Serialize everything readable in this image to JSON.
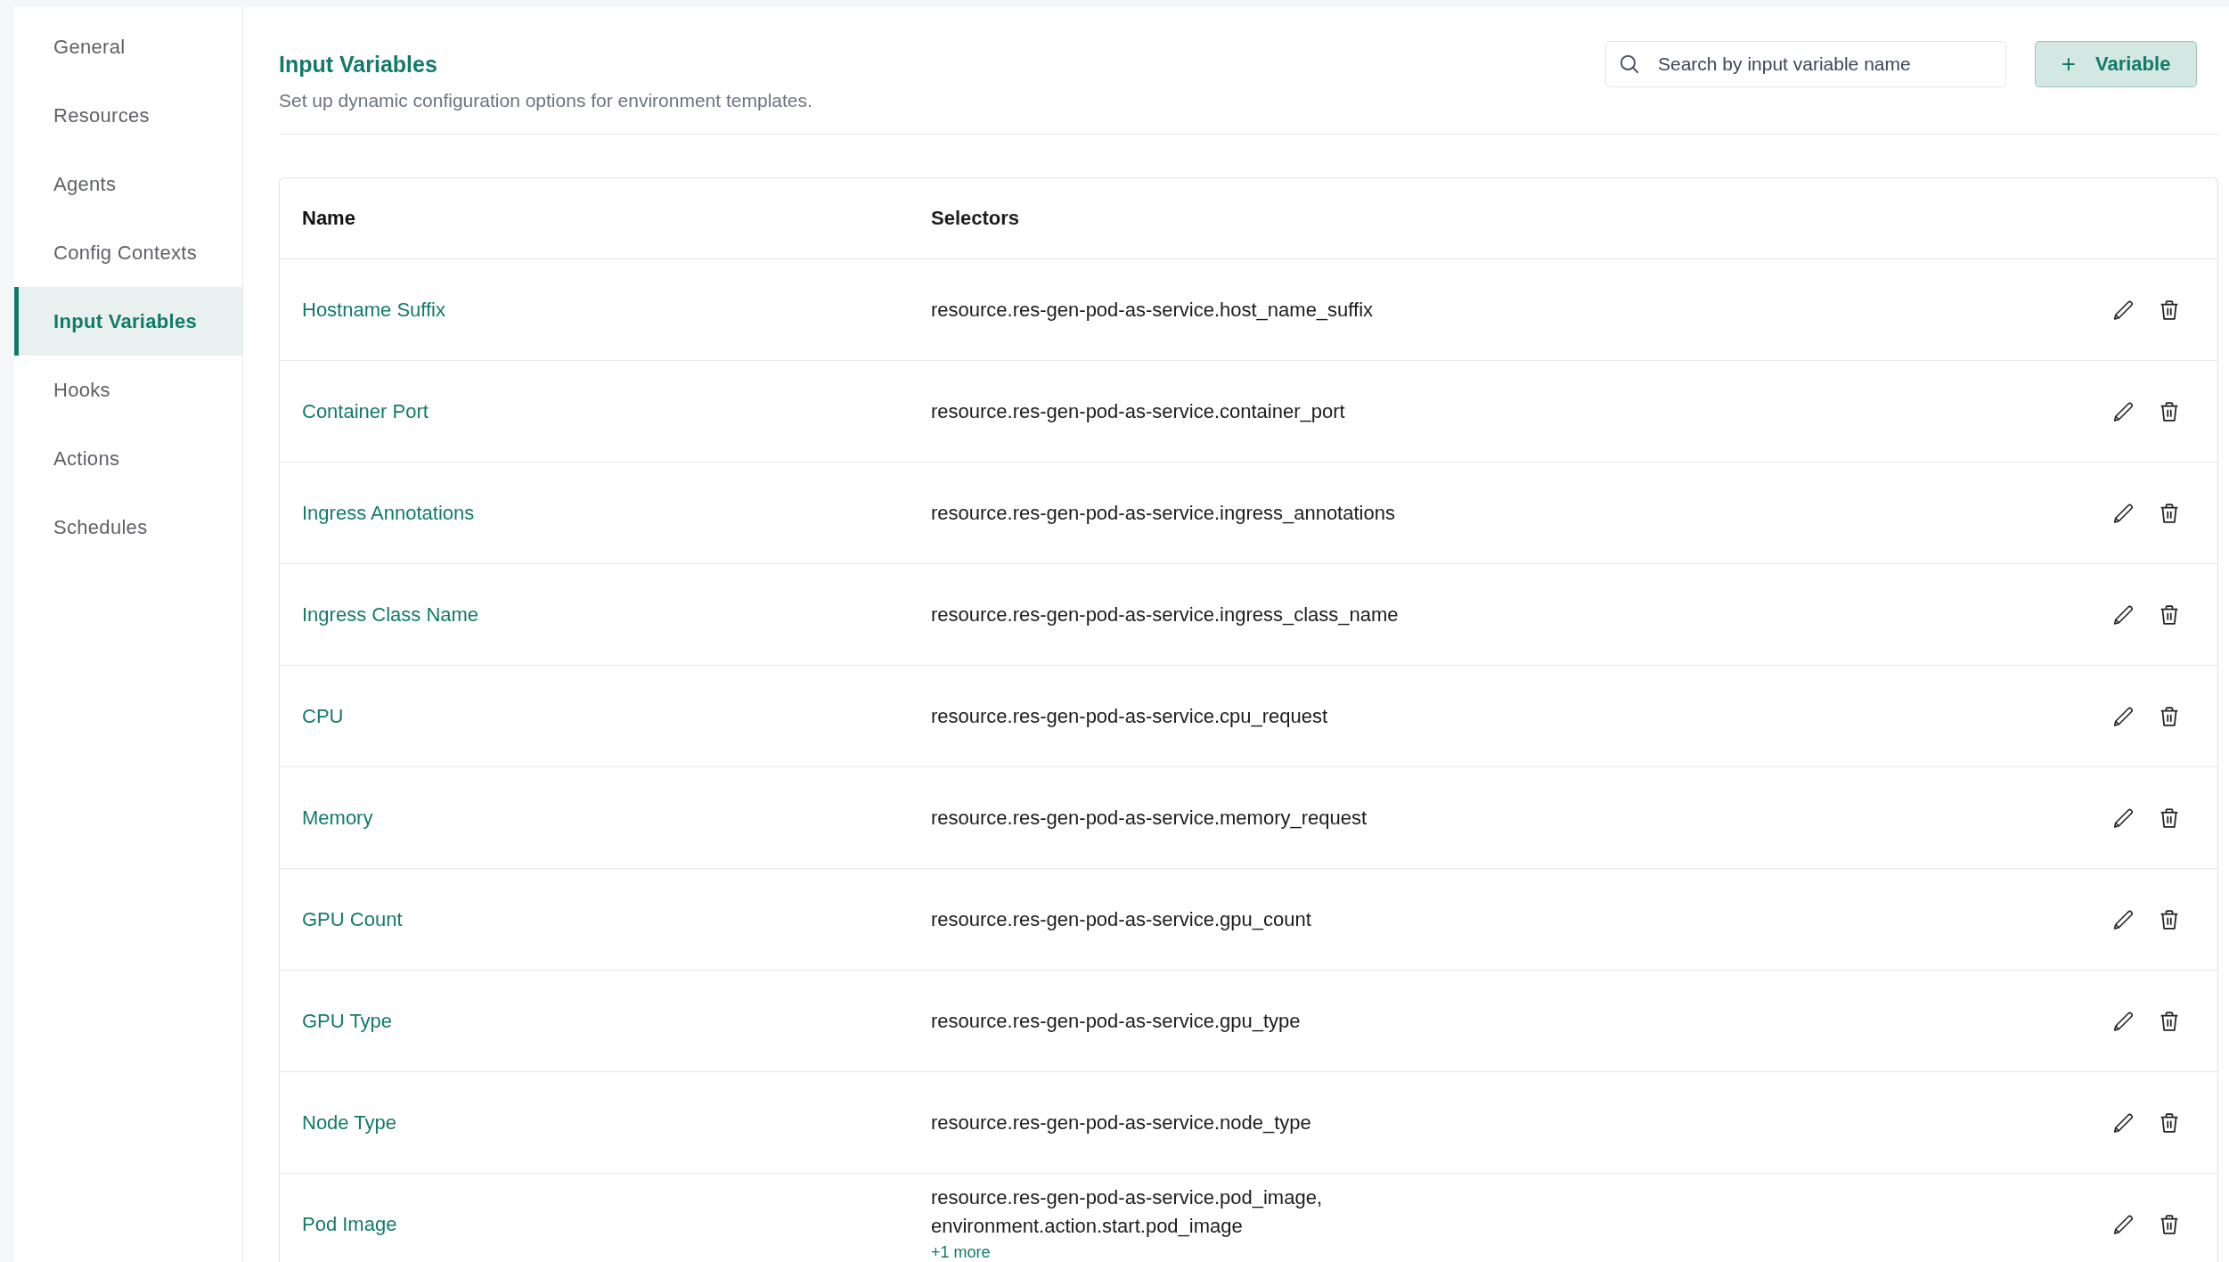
{
  "sidebar": {
    "items": [
      {
        "label": "General",
        "selected": false
      },
      {
        "label": "Resources",
        "selected": false
      },
      {
        "label": "Agents",
        "selected": false
      },
      {
        "label": "Config Contexts",
        "selected": false
      },
      {
        "label": "Input Variables",
        "selected": true
      },
      {
        "label": "Hooks",
        "selected": false
      },
      {
        "label": "Actions",
        "selected": false
      },
      {
        "label": "Schedules",
        "selected": false
      }
    ]
  },
  "header": {
    "title": "Input Variables",
    "subtitle": "Set up dynamic configuration options for environment templates."
  },
  "search": {
    "placeholder": "Search by input variable name"
  },
  "add_button": {
    "icon": "+",
    "label": "Variable"
  },
  "table": {
    "columns": [
      "Name",
      "Selectors"
    ],
    "rows": [
      {
        "name": "Hostname Suffix",
        "selectors": [
          "resource.res-gen-pod-as-service.host_name_suffix"
        ]
      },
      {
        "name": "Container Port",
        "selectors": [
          "resource.res-gen-pod-as-service.container_port"
        ]
      },
      {
        "name": "Ingress Annotations",
        "selectors": [
          "resource.res-gen-pod-as-service.ingress_annotations"
        ]
      },
      {
        "name": "Ingress Class Name",
        "selectors": [
          "resource.res-gen-pod-as-service.ingress_class_name"
        ]
      },
      {
        "name": "CPU",
        "selectors": [
          "resource.res-gen-pod-as-service.cpu_request"
        ]
      },
      {
        "name": "Memory",
        "selectors": [
          "resource.res-gen-pod-as-service.memory_request"
        ]
      },
      {
        "name": "GPU Count",
        "selectors": [
          "resource.res-gen-pod-as-service.gpu_count"
        ]
      },
      {
        "name": "GPU Type",
        "selectors": [
          "resource.res-gen-pod-as-service.gpu_type"
        ]
      },
      {
        "name": "Node Type",
        "selectors": [
          "resource.res-gen-pod-as-service.node_type"
        ]
      },
      {
        "name": "Pod Image",
        "selectors": [
          "resource.res-gen-pod-as-service.pod_image,",
          "environment.action.start.pod_image"
        ],
        "more": "+1 more"
      }
    ]
  }
}
